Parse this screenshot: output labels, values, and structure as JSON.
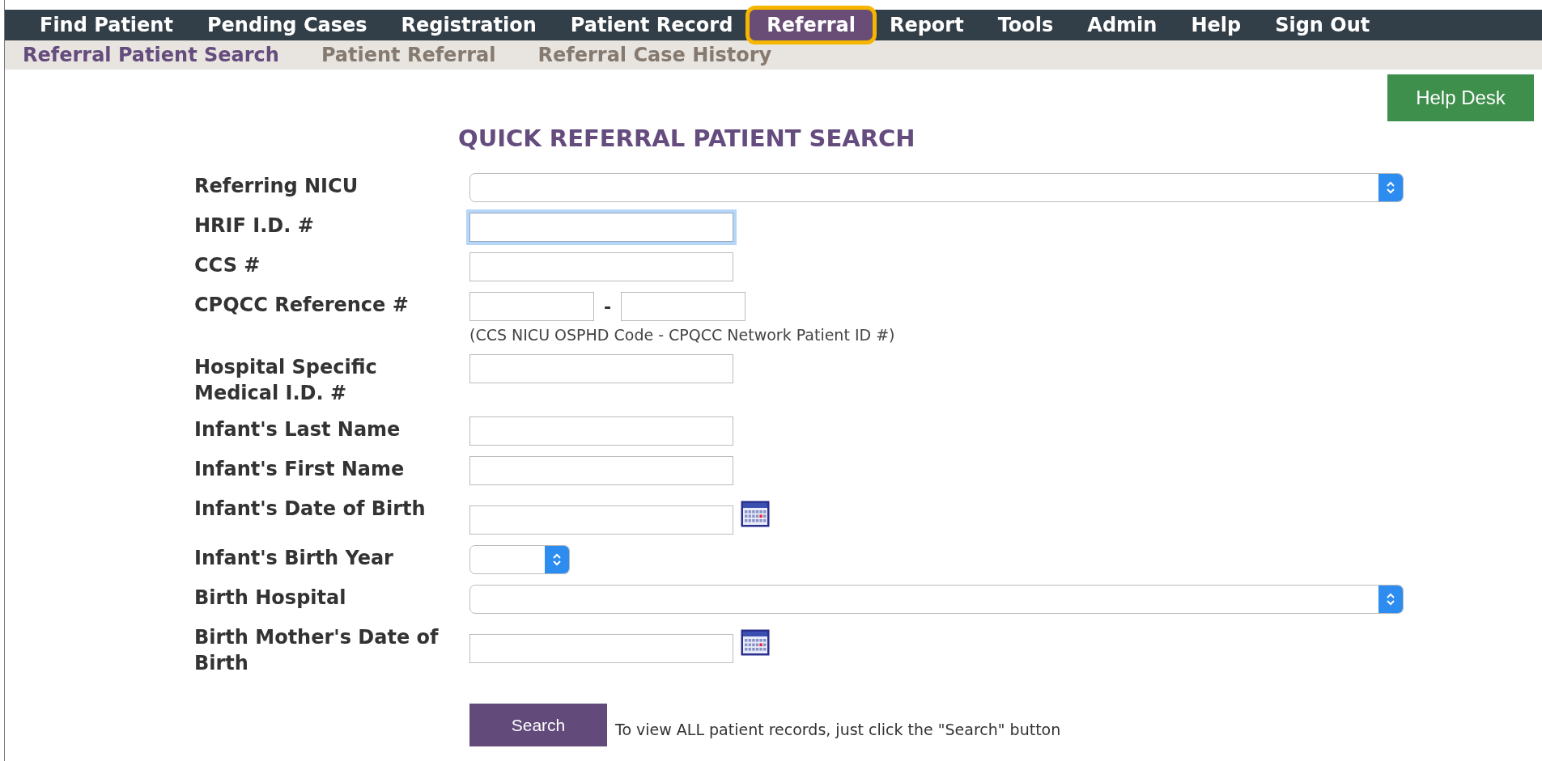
{
  "nav": [
    {
      "label": "Find Patient",
      "selected": false,
      "highlighted": false
    },
    {
      "label": "Pending Cases",
      "selected": false,
      "highlighted": false
    },
    {
      "label": "Registration",
      "selected": false,
      "highlighted": false
    },
    {
      "label": "Patient Record",
      "selected": false,
      "highlighted": false
    },
    {
      "label": "Referral",
      "selected": true,
      "highlighted": true
    },
    {
      "label": "Report",
      "selected": false,
      "highlighted": false
    },
    {
      "label": "Tools",
      "selected": false,
      "highlighted": false
    },
    {
      "label": "Admin",
      "selected": false,
      "highlighted": false
    },
    {
      "label": "Help",
      "selected": false,
      "highlighted": false
    },
    {
      "label": "Sign Out",
      "selected": false,
      "highlighted": false
    }
  ],
  "subnav": [
    {
      "label": "Referral Patient Search",
      "selected": true
    },
    {
      "label": "Patient Referral",
      "selected": false
    },
    {
      "label": "Referral Case History",
      "selected": false
    }
  ],
  "help_button": "Help Desk",
  "title": "QUICK REFERRAL PATIENT SEARCH",
  "fields": [
    {
      "label": "Referring NICU",
      "kind": "select"
    },
    {
      "label": "HRIF I.D. #",
      "kind": "text",
      "focused": true
    },
    {
      "label": "CCS #",
      "kind": "text",
      "focused": false
    },
    {
      "label": "CPQCC Reference #",
      "kind": "pair",
      "separator": "-",
      "note": "(CCS NICU OSPHD Code - CPQCC Network Patient ID #)"
    },
    {
      "label": "Hospital Specific Medical I.D. #",
      "kind": "text",
      "focused": false
    },
    {
      "label": "Infant's Last Name",
      "kind": "text",
      "focused": false
    },
    {
      "label": "Infant's First Name",
      "kind": "text",
      "focused": false
    },
    {
      "label": "Infant's Date of Birth",
      "kind": "date"
    },
    {
      "label": "Infant's Birth Year",
      "kind": "short-select"
    },
    {
      "label": "Birth Hospital",
      "kind": "select"
    },
    {
      "label": "Birth Mother's Date of Birth",
      "kind": "date"
    }
  ],
  "search_button": "Search",
  "search_hint": "To view ALL patient records, just click the \"Search\" button"
}
